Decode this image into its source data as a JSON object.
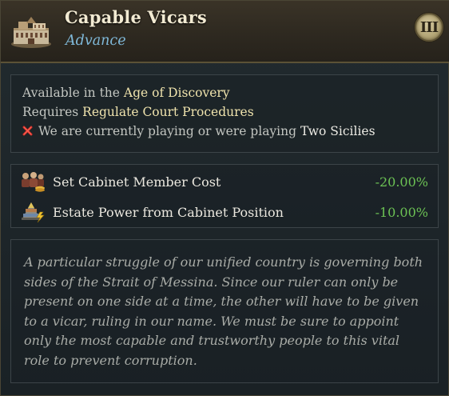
{
  "header": {
    "title": "Capable Vicars",
    "subtitle": "Advance",
    "tier": "III",
    "icon": "palace-building-icon"
  },
  "requirements": {
    "age_prefix": "Available in the ",
    "age_name": "Age of Discovery",
    "requires_prefix": "Requires ",
    "requires_name": "Regulate Court Procedures",
    "blocked_prefix": "We are currently playing or were playing ",
    "blocked_name": "Two Sicilies",
    "blocked_icon": "red-cross-icon"
  },
  "modifiers": [
    {
      "icon": "cabinet-members-icon",
      "label": "Set Cabinet Member Cost",
      "value": "-20.00%"
    },
    {
      "icon": "estate-pyramid-icon",
      "label": "Estate Power from Cabinet Position",
      "value": "-10.00%"
    }
  ],
  "description": "A particular struggle of our unified country is governing both sides of the Strait of Messina. Since our ruler can only be present on one side at a time, the other will have to be given to a vicar, ruling in our name. We must be sure to appoint only the most capable and trustworthy people to this vital role to prevent corruption.",
  "colors": {
    "title": "#f2ead2",
    "subtitle": "#7fb8d8",
    "highlight": "#efe3ad",
    "positive_modifier": "#6cc254"
  }
}
